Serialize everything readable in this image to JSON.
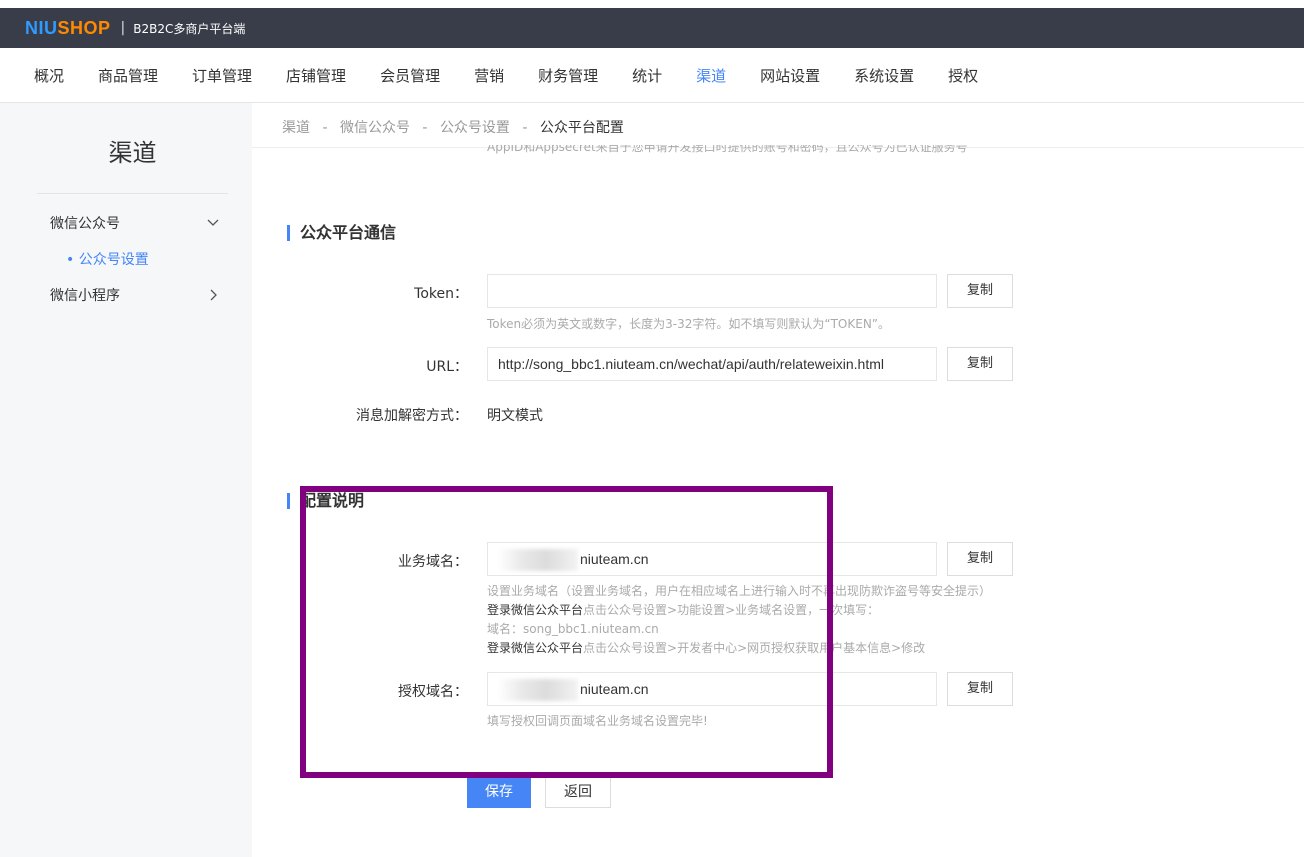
{
  "header": {
    "logo_part1": "NIU",
    "logo_part2": "SHOP",
    "separator": "|",
    "system_name": "B2B2C多商户平台端"
  },
  "nav": {
    "items": [
      "概况",
      "商品管理",
      "订单管理",
      "店铺管理",
      "会员管理",
      "营销",
      "财务管理",
      "统计",
      "渠道",
      "网站设置",
      "系统设置",
      "授权"
    ],
    "active": "渠道"
  },
  "sidebar": {
    "title": "渠道",
    "menu": [
      {
        "label": "微信公众号",
        "icon": "chevron-down-icon"
      },
      {
        "label": "微信小程序",
        "icon": "chevron-right-icon"
      }
    ],
    "sub_item": "• 公众号设置"
  },
  "breadcrumb": {
    "items": [
      "渠道",
      "微信公众号",
      "公众号设置",
      "公众平台配置"
    ],
    "separator": "-"
  },
  "cut_tip": "AppID和Appsecret来自于您申请开发接口时提供的账号和密码，且公众号为已认证服务号",
  "section_comm": {
    "title": "公众平台通信",
    "token_label": "Token：",
    "token_value": "",
    "token_tip": "Token必须为英文或数字，长度为3-32字符。如不填写则默认为“TOKEN”。",
    "url_label": "URL：",
    "url_value": "http://song_bbc1.niuteam.cn/wechat/api/auth/relateweixin.html",
    "encrypt_label": "消息加解密方式：",
    "encrypt_value": "明文模式",
    "copy_label": "复制"
  },
  "section_config": {
    "title": "配置说明",
    "business_label": "业务域名：",
    "business_value": "niuteam.cn",
    "business_tip1": "设置业务域名（设置业务域名，用户在相应域名上进行输入时不再出现防欺诈盗号等安全提示）",
    "business_tip2_dark": "登录微信公众平台",
    "business_tip2_rest": "点击公众号设置>功能设置>业务域名设置，一次填写：",
    "business_tip3": "域名：song_bbc1.niuteam.cn",
    "business_tip4_dark": "登录微信公众平台",
    "business_tip4_rest": "点击公众号设置>开发者中心>网页授权获取用户基本信息>修改",
    "auth_label": "授权域名：",
    "auth_value": "niuteam.cn",
    "auth_tip": "填写授权回调页面域名业务域名设置完毕!",
    "copy_label": "复制"
  },
  "actions": {
    "save": "保存",
    "back": "返回"
  },
  "colors": {
    "accent": "#4685f5",
    "topbar": "#393d49",
    "highlight": "#800080"
  }
}
